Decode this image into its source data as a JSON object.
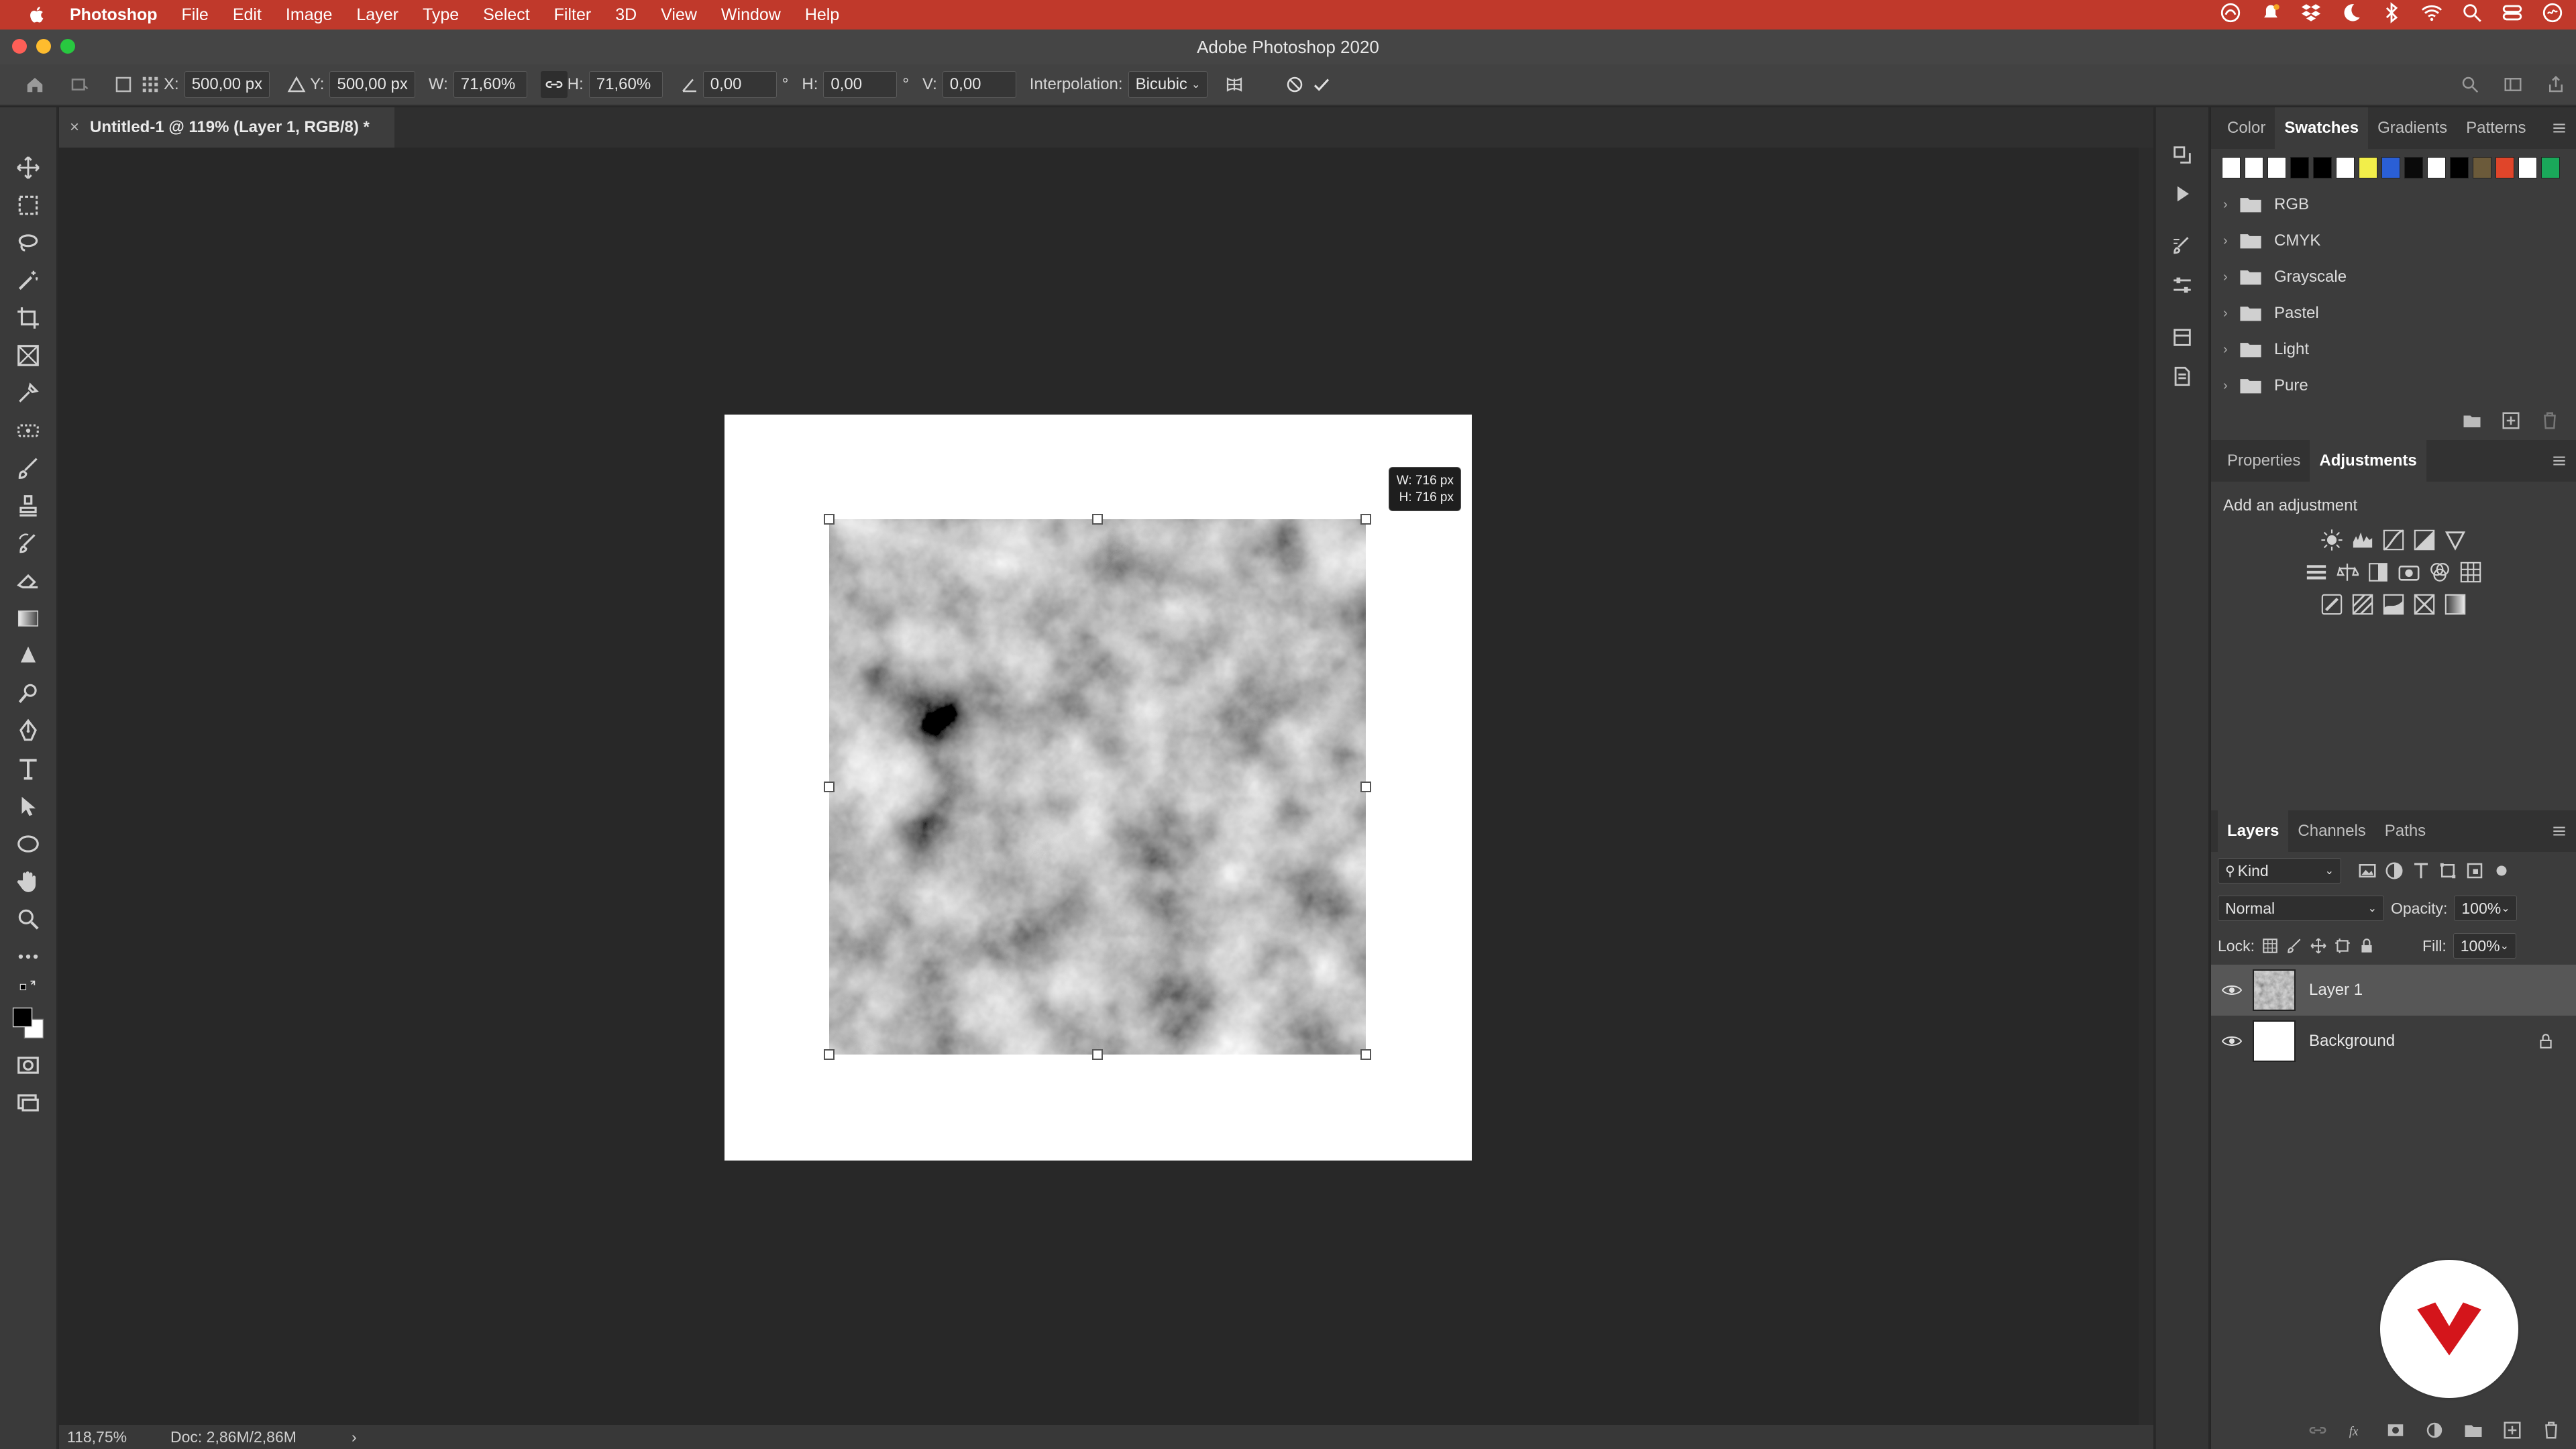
{
  "menubar": {
    "app_name": "Photoshop",
    "items": [
      "File",
      "Edit",
      "Image",
      "Layer",
      "Type",
      "Select",
      "Filter",
      "3D",
      "View",
      "Window",
      "Help"
    ],
    "bg_color": "#c0392b"
  },
  "window": {
    "title": "Adobe Photoshop 2020"
  },
  "options": {
    "x_label": "X:",
    "x_value": "500,00 px",
    "y_label": "Y:",
    "y_value": "500,00 px",
    "w_label": "W:",
    "w_value": "71,60%",
    "h_label": "H:",
    "h_value": "71,60%",
    "angle_value": "0,00",
    "angle_unit": "°",
    "hskew_label": "H:",
    "hskew_value": "0,00",
    "hskew_unit": "°",
    "vskew_label": "V:",
    "vskew_value": "0,00",
    "interp_label": "Interpolation:",
    "interp_value": "Bicubic"
  },
  "document": {
    "tab_title": "Untitled-1 @ 119% (Layer 1, RGB/8) *",
    "size_tip_w": "W: 716 px",
    "size_tip_h": "H: 716 px"
  },
  "status": {
    "zoom": "118,75%",
    "doc": "Doc: 2,86M/2,86M",
    "arrow": "›"
  },
  "swatches_panel": {
    "tabs": [
      "Color",
      "Swatches",
      "Gradients",
      "Patterns"
    ],
    "active_tab": "Swatches",
    "colors": [
      "#ffffff",
      "#ffffff",
      "#ffffff",
      "#000000",
      "#000000",
      "#ffffff",
      "#f2ee4a",
      "#2a5fd6",
      "#0a0a0a",
      "#ffffff",
      "#000000",
      "#6b5a3a",
      "#e0452a",
      "#ffffff",
      "#1aa85a"
    ],
    "folders": [
      "RGB",
      "CMYK",
      "Grayscale",
      "Pastel",
      "Light",
      "Pure"
    ]
  },
  "adjust_panel": {
    "tabs": [
      "Properties",
      "Adjustments"
    ],
    "active_tab": "Adjustments",
    "label": "Add an adjustment"
  },
  "layers_panel": {
    "tabs": [
      "Layers",
      "Channels",
      "Paths"
    ],
    "active_tab": "Layers",
    "filter_label": "Kind",
    "blend_mode": "Normal",
    "opacity_label": "Opacity:",
    "opacity_value": "100%",
    "lock_label": "Lock:",
    "fill_label": "Fill:",
    "fill_value": "100%",
    "layers": [
      {
        "name": "Layer 1",
        "selected": true
      },
      {
        "name": "Background",
        "selected": false
      }
    ]
  },
  "colors": {
    "accent_logo": "#d4151b",
    "canvas_bg": "#282828"
  }
}
